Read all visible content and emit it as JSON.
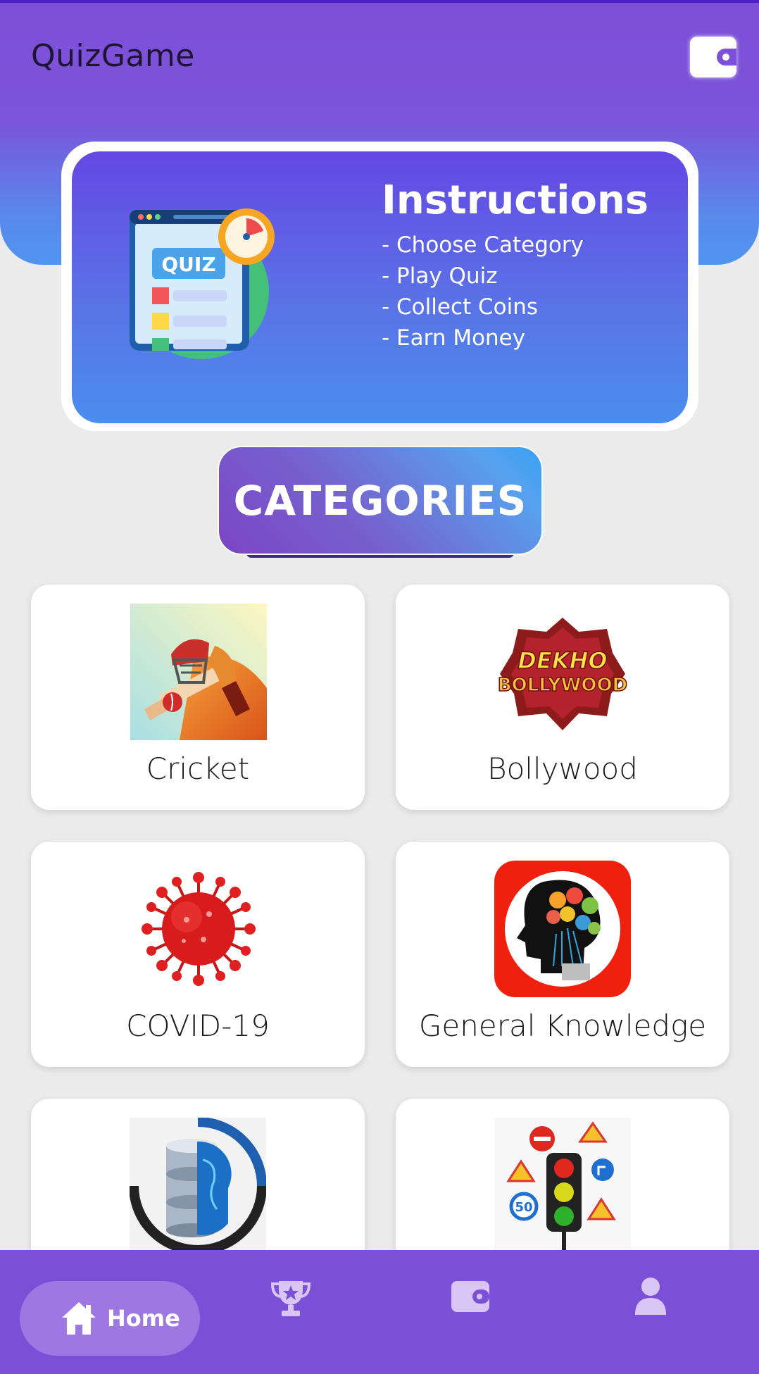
{
  "app": {
    "title": "QuizGame"
  },
  "header": {
    "wallet_icon": "wallet-icon"
  },
  "instructions": {
    "title": "Instructions",
    "lines": [
      "- Choose Category",
      "- Play Quiz",
      "- Collect Coins",
      "- Earn Money"
    ],
    "illustration_text": "QUIZ"
  },
  "categories_button": {
    "label": "CATEGORIES"
  },
  "categories": [
    {
      "name": "Cricket",
      "icon": "cricket-batsman-icon"
    },
    {
      "name": "Bollywood",
      "icon": "dekho-bollywood-logo",
      "logo_text": [
        "DEKHO",
        "BOLLYWOOD"
      ]
    },
    {
      "name": "COVID-19",
      "icon": "virus-icon"
    },
    {
      "name": "General Knowledge",
      "icon": "brain-head-icon"
    },
    {
      "name": "",
      "icon": "database-globe-icon"
    },
    {
      "name": "",
      "icon": "traffic-signs-icon",
      "sign_text": "50"
    }
  ],
  "bottom_nav": {
    "home_label": "Home",
    "items": [
      "home-icon",
      "trophy-icon",
      "wallet-icon",
      "profile-icon"
    ]
  },
  "colors": {
    "primary": "#7b4fd6",
    "card_gradient_top": "#6448e4",
    "card_gradient_bottom": "#4a8eee",
    "background": "#ebebeb"
  }
}
